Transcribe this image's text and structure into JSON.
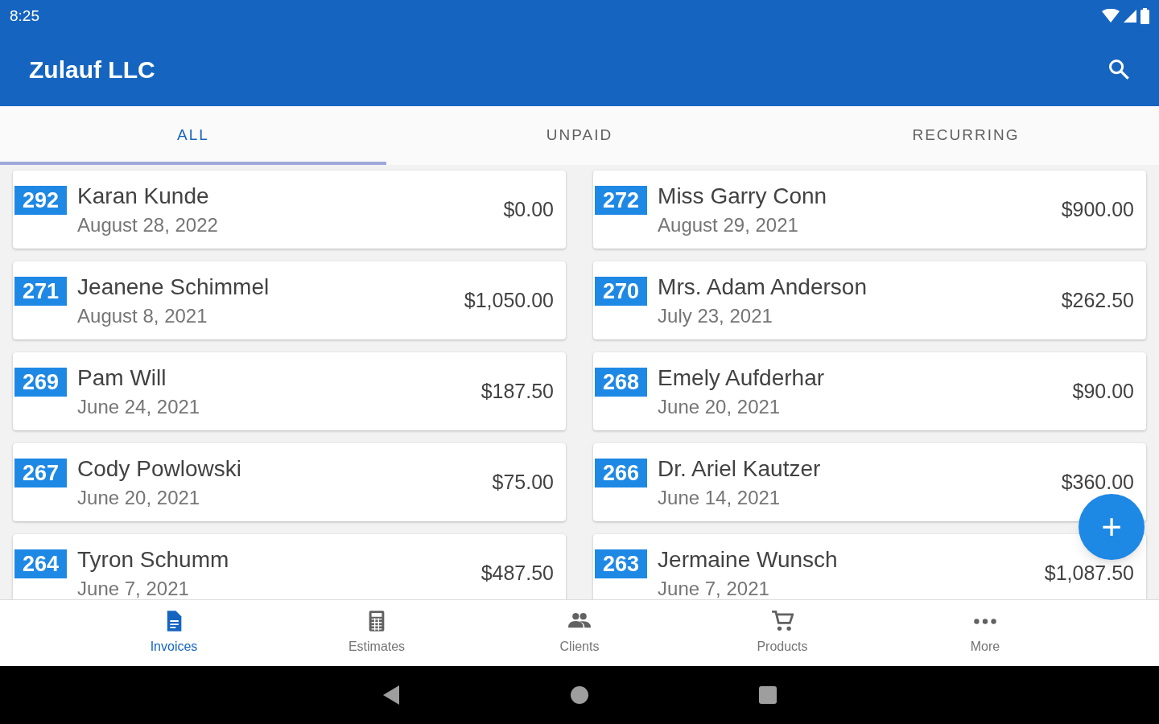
{
  "status_bar": {
    "time": "8:25"
  },
  "app_bar": {
    "title": "Zulauf LLC"
  },
  "tabs": [
    {
      "label": "ALL",
      "selected": true
    },
    {
      "label": "UNPAID",
      "selected": false
    },
    {
      "label": "RECURRING",
      "selected": false
    }
  ],
  "invoices": [
    {
      "number": "292",
      "client": "Karan Kunde",
      "date": "August 28, 2022",
      "amount": "$0.00"
    },
    {
      "number": "272",
      "client": "Miss Garry Conn",
      "date": "August 29, 2021",
      "amount": "$900.00"
    },
    {
      "number": "271",
      "client": "Jeanene Schimmel",
      "date": "August 8, 2021",
      "amount": "$1,050.00"
    },
    {
      "number": "270",
      "client": "Mrs. Adam Anderson",
      "date": "July 23, 2021",
      "amount": "$262.50"
    },
    {
      "number": "269",
      "client": "Pam Will",
      "date": "June 24, 2021",
      "amount": "$187.50"
    },
    {
      "number": "268",
      "client": "Emely Aufderhar",
      "date": "June 20, 2021",
      "amount": "$90.00"
    },
    {
      "number": "267",
      "client": "Cody Powlowski",
      "date": "June 20, 2021",
      "amount": "$75.00"
    },
    {
      "number": "266",
      "client": "Dr. Ariel Kautzer",
      "date": "June 14, 2021",
      "amount": "$360.00"
    },
    {
      "number": "264",
      "client": "Tyron Schumm",
      "date": "June 7, 2021",
      "amount": "$487.50"
    },
    {
      "number": "263",
      "client": "Jermaine Wunsch",
      "date": "June 7, 2021",
      "amount": "$1,087.50"
    }
  ],
  "fab": {
    "label": "+"
  },
  "bottom_nav": [
    {
      "kind": "invoices",
      "label": "Invoices",
      "selected": true
    },
    {
      "kind": "estimates",
      "label": "Estimates",
      "selected": false
    },
    {
      "kind": "clients",
      "label": "Clients",
      "selected": false
    },
    {
      "kind": "products",
      "label": "Products",
      "selected": false
    },
    {
      "kind": "more",
      "label": "More",
      "selected": false
    }
  ]
}
